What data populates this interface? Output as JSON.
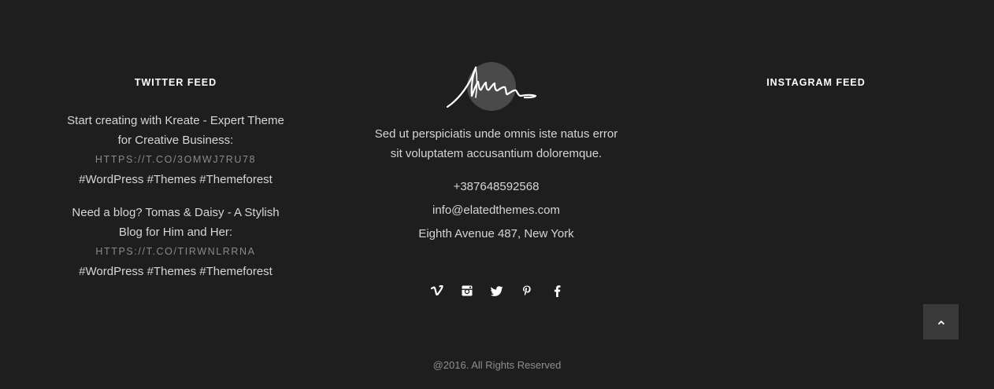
{
  "twitter": {
    "title": "TWITTER FEED",
    "tweets": [
      {
        "text": "Start creating with Kreate - Expert Theme for Creative Business:",
        "link": "HTTPS://T.CO/3OMWJ7RU78",
        "tags": "#WordPress #Themes #Themeforest"
      },
      {
        "text": "Need a blog? Tomas & Daisy - A Stylish Blog for Him and Her:",
        "link": "HTTPS://T.CO/TIRWNLRRNA",
        "tags": "#WordPress #Themes #Themeforest"
      }
    ]
  },
  "about": {
    "text": "Sed ut perspiciatis unde omnis iste natus error sit voluptatem accusantium doloremque."
  },
  "contact": {
    "phone": "+387648592568",
    "email": "info@elatedthemes.com",
    "address": "Eighth Avenue 487, New York"
  },
  "social_icons": [
    "vimeo-icon",
    "instagram-icon",
    "twitter-icon",
    "pinterest-icon",
    "facebook-icon"
  ],
  "instagram": {
    "title": "INSTAGRAM FEED"
  },
  "footer": {
    "copyright": "@2016. All Rights Reserved"
  },
  "colors": {
    "background": "#1e1e1e",
    "back_to_top_bg": "#3a3a3a",
    "logo_circle": "#4a4a4a"
  }
}
